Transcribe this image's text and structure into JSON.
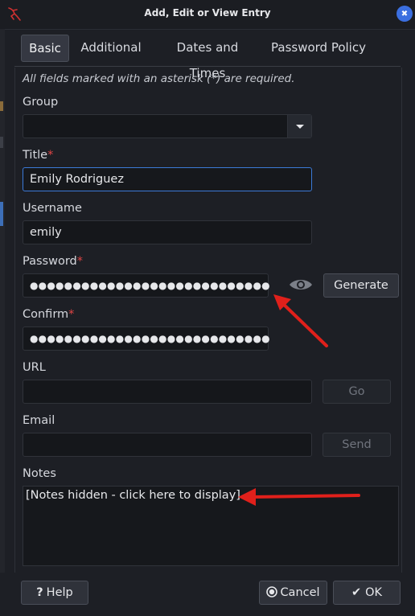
{
  "window": {
    "title": "Add, Edit or View Entry",
    "close_glyph": "✖"
  },
  "tabs": [
    {
      "label": "Basic",
      "active": true
    },
    {
      "label": "Additional",
      "active": false
    },
    {
      "label": "Dates and Times",
      "active": false
    },
    {
      "label": "Password Policy",
      "active": false
    }
  ],
  "form": {
    "required_hint": "All fields marked with an asterisk (*) are required.",
    "group": {
      "label": "Group",
      "value": ""
    },
    "title": {
      "label": "Title",
      "required_mark": "*",
      "value": "Emily Rodriguez"
    },
    "username": {
      "label": "Username",
      "value": "emily"
    },
    "password": {
      "label": "Password",
      "required_mark": "*",
      "value": "●●●●●●●●●●●●●●●●●●●●●●●●●●●●"
    },
    "confirm": {
      "label": "Confirm",
      "required_mark": "*",
      "value": "●●●●●●●●●●●●●●●●●●●●●●●●●●●●"
    },
    "url": {
      "label": "URL",
      "value": ""
    },
    "email": {
      "label": "Email",
      "value": ""
    },
    "notes": {
      "label": "Notes",
      "value": "[Notes hidden - click here to display]"
    }
  },
  "buttons": {
    "generate": "Generate",
    "go": "Go",
    "send": "Send",
    "help": "Help",
    "help_glyph": "?",
    "cancel": "Cancel",
    "ok": "OK",
    "ok_glyph": "✔"
  },
  "icons": {
    "app": "kali-dragon-icon",
    "eye": "show-password-icon",
    "combo": "chevron-down-icon",
    "cancel": "cancel-circle-icon"
  },
  "colors": {
    "accent": "#3b6fe0",
    "required": "#e04545",
    "annotation_arrow": "#e0201b"
  }
}
